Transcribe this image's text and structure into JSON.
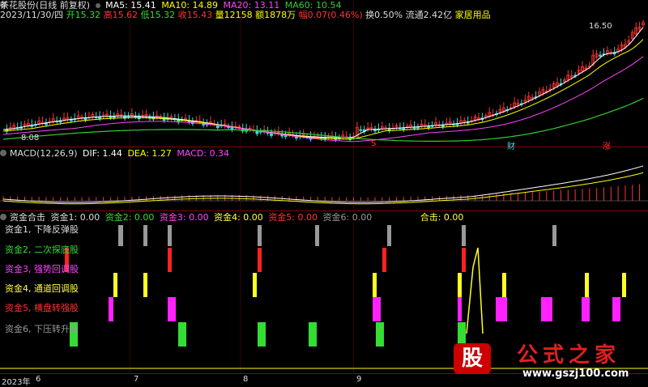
{
  "header": {
    "name": "茶花股份(日线 前复权)",
    "ma5": "MA5: 15.41",
    "ma10": "MA10: 14.89",
    "ma20": "MA20: 13.11",
    "ma60": "MA60: 10.54",
    "date": "2023/11/30/四",
    "open": "开15.32",
    "high": "高15.62",
    "low": "低15.32",
    "close": "收15.43",
    "volume": "量12158",
    "amount": "额1878万",
    "change": "幅0.07(0.46%)",
    "turnover": "换0.50%",
    "float": "流通2.42亿",
    "industry": "家居用品"
  },
  "price_marks": {
    "high": "16.50",
    "low": "8.08"
  },
  "event_marks": {
    "m1": "S",
    "m2": "财",
    "m3": "涨"
  },
  "macd": {
    "title": "MACD(12,26,9)",
    "dif": "DIF: 1.44",
    "dea": "DEA: 1.27",
    "macd": "MACD: 0.34"
  },
  "indicator": {
    "title": "资金合击",
    "f1": "资金1: 0.00",
    "f2": "资金2: 0.00",
    "f3": "资金3: 0.00",
    "f4": "资金4: 0.00",
    "f5": "资金5: 0.00",
    "f6": "资金6: 0.00",
    "combined": "合击: 0.00",
    "rows": [
      {
        "label": "资金1, 下降反弹股",
        "color": "#dddddd"
      },
      {
        "label": "资金2, 二次探底股",
        "color": "#33dd33"
      },
      {
        "label": "资金3, 强势回调股",
        "color": "#ff44ff"
      },
      {
        "label": "资金4, 通道回调股",
        "color": "#ffff44"
      },
      {
        "label": "资金5, 横盘转强股",
        "color": "#ff3333"
      },
      {
        "label": "资金6, 下压转升股",
        "color": "#999999"
      }
    ]
  },
  "axis": {
    "year": "2023年",
    "m6": "6",
    "m7": "7",
    "m8": "8",
    "m9": "9"
  },
  "watermark": {
    "icon": "股",
    "brand": "公式之家",
    "url": "www.gszj100.com"
  },
  "colors": {
    "up": "#ff3333",
    "down": "#33dddd",
    "ma5": "#ffffff",
    "ma10": "#ffff00",
    "ma20": "#ff44ff",
    "ma60": "#33cc33",
    "bg": "#000000"
  }
}
